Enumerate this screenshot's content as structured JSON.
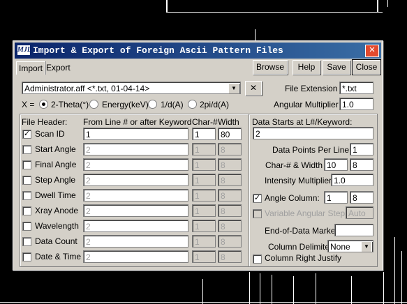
{
  "window": {
    "title": "Import & Export of Foreign Ascii Pattern Files",
    "logo": "MJL",
    "close_glyph": "✕"
  },
  "tabs": [
    "Import",
    "Export"
  ],
  "buttons": {
    "browse": "Browse",
    "help": "Help",
    "save": "Save",
    "close": "Close"
  },
  "file": {
    "selected": "Administrator.aff <*.txt, 01-04-14>",
    "clear_glyph": "✕",
    "extension_label": "File Extension =",
    "extension_value": "*.txt"
  },
  "xaxis": {
    "label": "X =",
    "options": [
      "2-Theta(°)",
      "Energy(keV)",
      "1/d(A)",
      "2pi/d(A)"
    ],
    "selected_index": 0,
    "angular_label": "Angular Multiplier =",
    "angular_value": "1.0"
  },
  "header": {
    "col_file_header": "File Header:",
    "col_from_line": "From Line # or after Keyword",
    "col_char": "Char-#",
    "col_width": "Width",
    "rows": [
      {
        "label": "Scan ID",
        "checked": true,
        "line": "1",
        "char": "1",
        "width": "80"
      },
      {
        "label": "Start Angle",
        "checked": false,
        "line": "2",
        "char": "1",
        "width": "8"
      },
      {
        "label": "Final Angle",
        "checked": false,
        "line": "2",
        "char": "1",
        "width": "8"
      },
      {
        "label": "Step Angle",
        "checked": false,
        "line": "2",
        "char": "1",
        "width": "8"
      },
      {
        "label": "Dwell Time",
        "checked": false,
        "line": "2",
        "char": "1",
        "width": "8"
      },
      {
        "label": "Xray Anode",
        "checked": false,
        "line": "2",
        "char": "1",
        "width": "8"
      },
      {
        "label": "Wavelength",
        "checked": false,
        "line": "2",
        "char": "1",
        "width": "8"
      },
      {
        "label": "Data Count",
        "checked": false,
        "line": "2",
        "char": "1",
        "width": "8"
      },
      {
        "label": "Date & Time",
        "checked": false,
        "line": "2",
        "char": "1",
        "width": "8"
      }
    ]
  },
  "data": {
    "starts_label": "Data Starts at L#/Keyword:",
    "starts_value": "2",
    "per_line_label": "Data Points Per Line =",
    "per_line_value": "1",
    "char_width_label": "Char-# & Width =",
    "char_value": "10",
    "width_value": "8",
    "intensity_label": "Intensity Multiplier =",
    "intensity_value": "1.0",
    "angle_col_label": "Angle Column:",
    "angle_col_checked": true,
    "angle_col_char": "1",
    "angle_col_width": "8",
    "var_steps_label": "Variable Angular Steps:",
    "var_steps_value": "Auto",
    "eod_label": "End-of-Data Marker:",
    "eod_value": "",
    "delim_label": "Column Delimiter:",
    "delim_value": "None",
    "right_justify_label": "Column Right Justify",
    "right_justify_checked": false
  },
  "glyphs": {
    "check": "✓",
    "dropdown": "▼"
  }
}
